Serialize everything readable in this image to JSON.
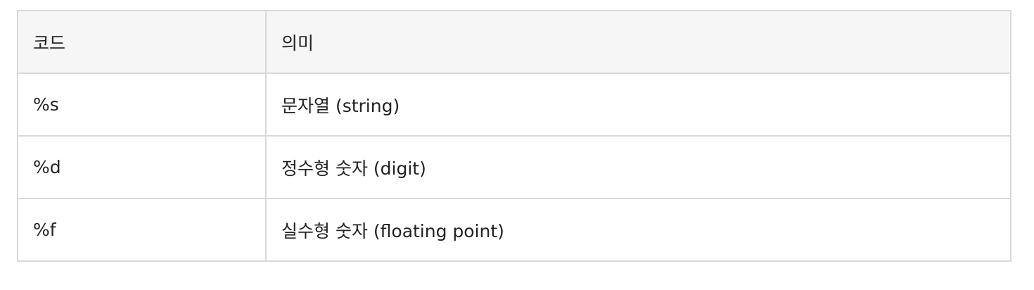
{
  "table": {
    "headers": [
      "코드",
      "의미"
    ],
    "rows": [
      [
        "%s",
        "문자열 (string)"
      ],
      [
        "%d",
        "정수형 숫자 (digit)"
      ],
      [
        "%f",
        "실수형 숫자 (floating point)"
      ]
    ]
  },
  "colors": {
    "header_bg": "#f6f6f6",
    "border": "#d9d9d9",
    "text": "#222222"
  }
}
